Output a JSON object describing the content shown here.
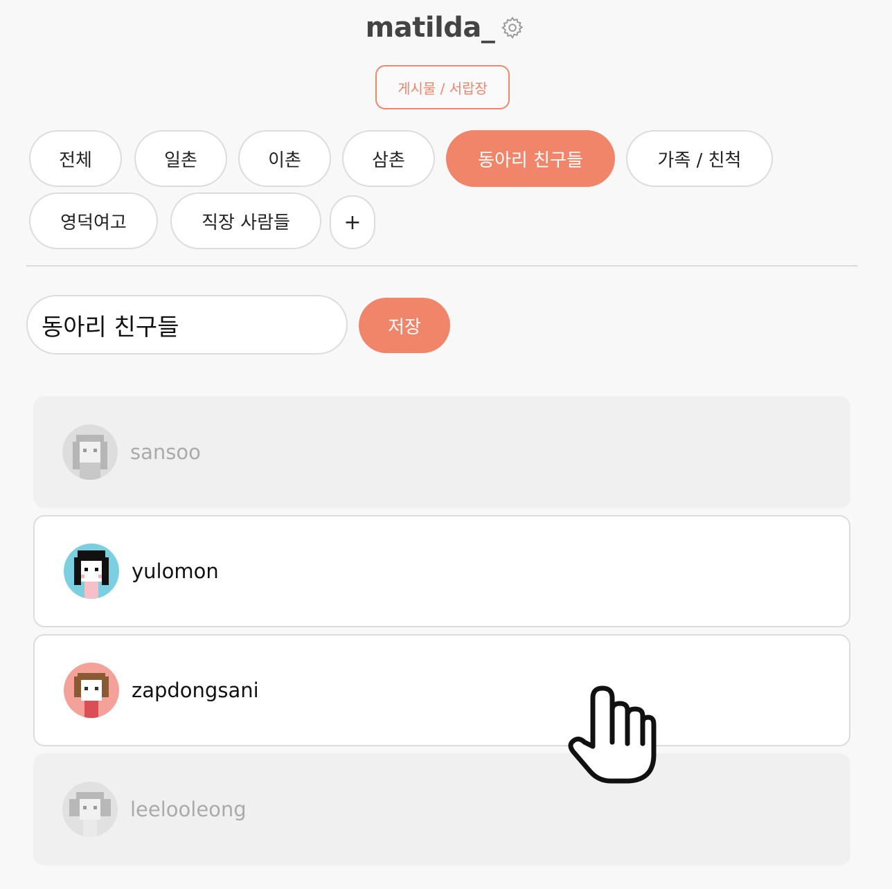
{
  "profile": {
    "username": "matilda_",
    "settings_icon": "gear-icon"
  },
  "view_toggle": {
    "label": "게시물 / 서랍장"
  },
  "groups": [
    {
      "label": "전체",
      "active": false
    },
    {
      "label": "일촌",
      "active": false
    },
    {
      "label": "이촌",
      "active": false
    },
    {
      "label": "삼촌",
      "active": false
    },
    {
      "label": "동아리 친구들",
      "active": true
    },
    {
      "label": "가족 / 친척",
      "active": false
    },
    {
      "label": "영덕여고",
      "active": false
    },
    {
      "label": "직장 사람들",
      "active": false
    }
  ],
  "add_group": {
    "label": "+"
  },
  "editor": {
    "group_name_value": "동아리 친구들",
    "save_label": "저장"
  },
  "friends": [
    {
      "name": "sansoo",
      "selected": false,
      "avatar_bg": "#cfcfcf"
    },
    {
      "name": "yulomon",
      "selected": true,
      "avatar_bg": "#7ccfe0"
    },
    {
      "name": "zapdongsani",
      "selected": true,
      "avatar_bg": "#f4a19a"
    },
    {
      "name": "leelooleong",
      "selected": false,
      "avatar_bg": "#d5d5d5"
    }
  ],
  "colors": {
    "accent": "#f0856a",
    "border": "#dcdcdc",
    "dim_row": "#f0f0f0"
  }
}
